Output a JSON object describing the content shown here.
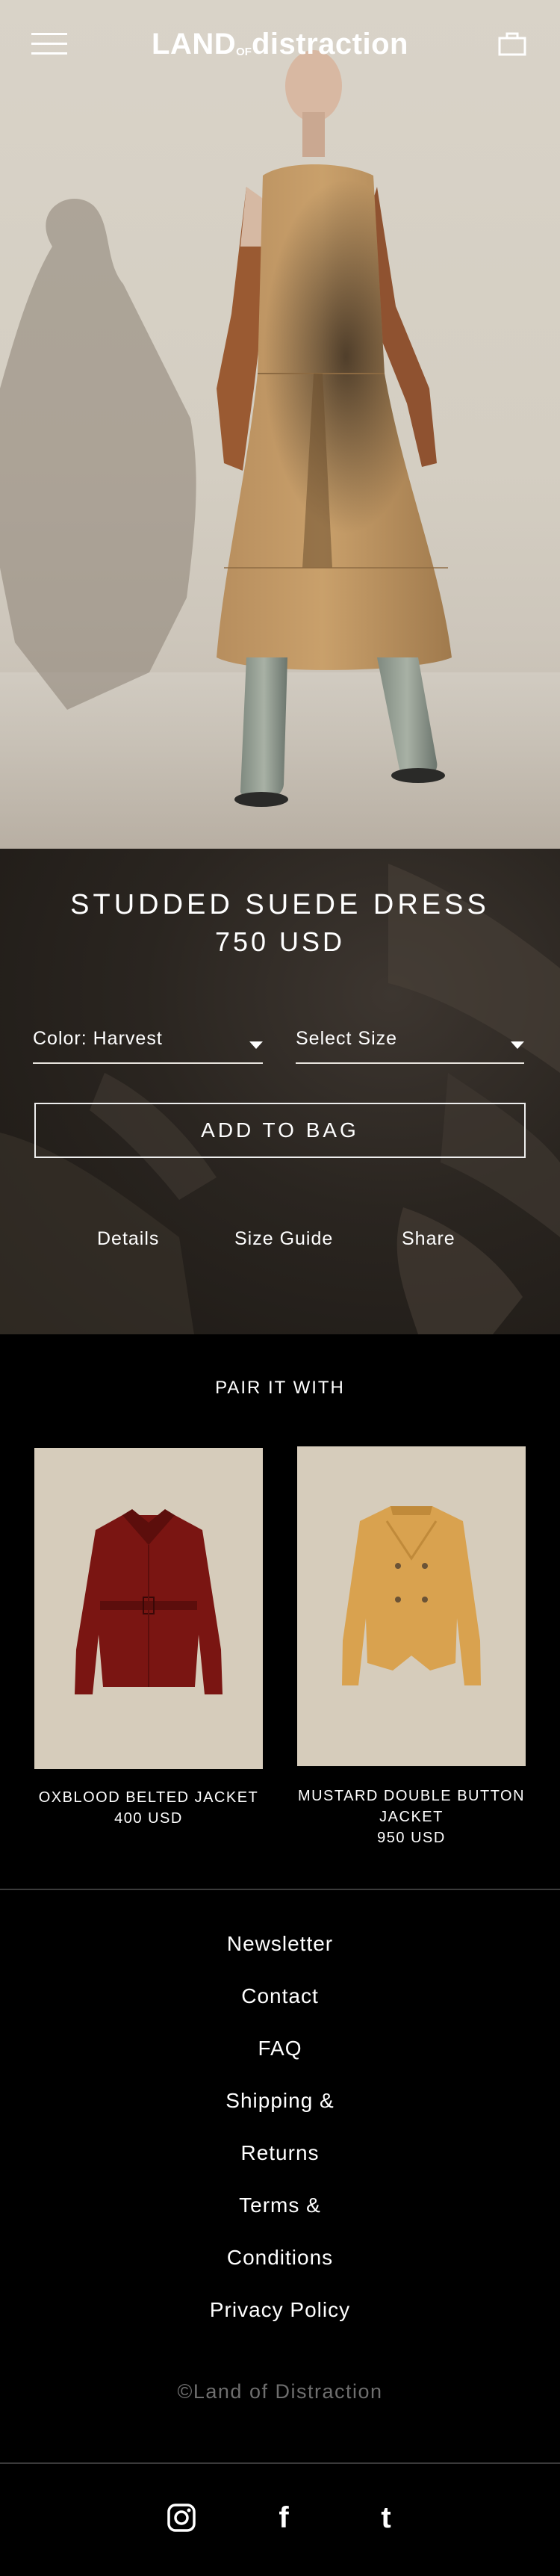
{
  "header": {
    "logo_left": "LAND",
    "logo_of": "OF",
    "logo_right": "distraction"
  },
  "product": {
    "title": "STUDDED SUEDE DRESS",
    "price": "750 USD",
    "color_select": "Color: Harvest",
    "size_select": "Select Size",
    "add_to_bag": "ADD TO BAG",
    "links": [
      "Details",
      "Size Guide",
      "Share"
    ]
  },
  "pair": {
    "title": "PAIR IT WITH",
    "items": [
      {
        "name": "OXBLOOD BELTED JACKET",
        "price": "400 USD",
        "color": "#7a1512"
      },
      {
        "name_line1": "MUSTARD DOUBLE BUTTON",
        "name_line2": "JACKET",
        "price": "950 USD",
        "color": "#d9a24f"
      }
    ]
  },
  "footer": {
    "links": [
      "Newsletter",
      "Contact",
      "FAQ",
      "Shipping &",
      "Returns",
      "Terms &",
      "Conditions",
      "Privacy Policy"
    ],
    "copyright": "©Land of Distraction",
    "social": [
      "instagram-icon",
      "facebook-icon",
      "tumblr-icon"
    ]
  },
  "colors": {
    "hero_wall": "#d9d3c8",
    "dress": "#c49a66",
    "product_bg": "#2a2520",
    "card_bg": "#d6ccbb",
    "copyright_gray": "#6e6e6e"
  }
}
